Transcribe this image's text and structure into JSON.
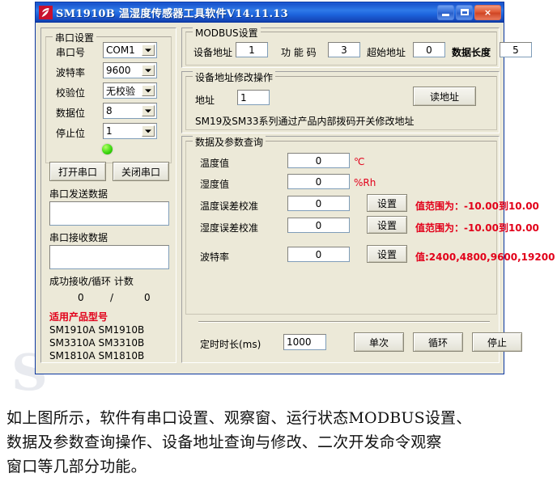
{
  "window": {
    "title": "SM1910B 温湿度传感器工具软件V14.11.13",
    "logo_icon": "app-logo-icon",
    "buttons": {
      "minimize": "minimize-icon",
      "maximize": "maximize-icon",
      "close": "×"
    }
  },
  "serial_settings": {
    "group_title": "串口设置",
    "fields": [
      {
        "label": "串口号",
        "value": "COM1"
      },
      {
        "label": "波特率",
        "value": "9600"
      },
      {
        "label": "校验位",
        "value": "无校验"
      },
      {
        "label": "数据位",
        "value": "8"
      },
      {
        "label": "停止位",
        "value": "1"
      }
    ],
    "status_led_color": "#3ddb15",
    "open_button": "打开串口",
    "close_button": "关闭串口",
    "send_label": "串口发送数据",
    "send_value": "",
    "recv_label": "串口接收数据",
    "recv_value": "",
    "counter_label": "成功接收/循环 计数",
    "counter_recv": "0",
    "counter_sep": "/",
    "counter_loop": "0",
    "models_title": "适用产品型号",
    "models": [
      "SM1910A SM1910B",
      "SM3310A SM3310B",
      "SM1810A SM1810B"
    ]
  },
  "modbus": {
    "group_title": "MODBUS设置",
    "fields": [
      {
        "label": "设备地址",
        "value": "1"
      },
      {
        "label": "功 能 码",
        "value": "3"
      },
      {
        "label": "超始地址",
        "value": "0"
      },
      {
        "label": "数据长度",
        "value": "5"
      }
    ]
  },
  "device_address": {
    "group_title": "设备地址修改操作",
    "address_label": "地址",
    "address_value": "1",
    "read_button": "读地址",
    "note": "SM19及SM33系列通过产品内部拨码开关修改地址"
  },
  "data_query": {
    "group_title": "数据及参数查询",
    "rows": [
      {
        "label": "温度值",
        "value": "0",
        "unit": "℃",
        "button": "",
        "hint": ""
      },
      {
        "label": "湿度值",
        "value": "0",
        "unit": "%Rh",
        "button": "",
        "hint": ""
      },
      {
        "label": "温度误差校准",
        "value": "0",
        "unit": "",
        "button": "设置",
        "hint": "值范围为：-10.00到10.00"
      },
      {
        "label": "湿度误差校准",
        "value": "0",
        "unit": "",
        "button": "设置",
        "hint": "值范围为：-10.00到10.00"
      },
      {
        "label": "波特率",
        "value": "0",
        "unit": "",
        "button": "设置",
        "hint": "值:2400,4800,9600,19200"
      }
    ],
    "timer_label": "定时时长(ms)",
    "timer_value": "1000",
    "single_button": "单次",
    "loop_button": "循环",
    "stop_button": "停止"
  },
  "caption": {
    "line1": "如上图所示，软件有串口设置、观察窗、运行状态MODBUS设置、",
    "line2": "数据及参数查询操作、设备地址查询与修改、二次开发命令观察",
    "line3": "窗口等几部分功能。"
  },
  "watermark": {
    "text": "S"
  }
}
